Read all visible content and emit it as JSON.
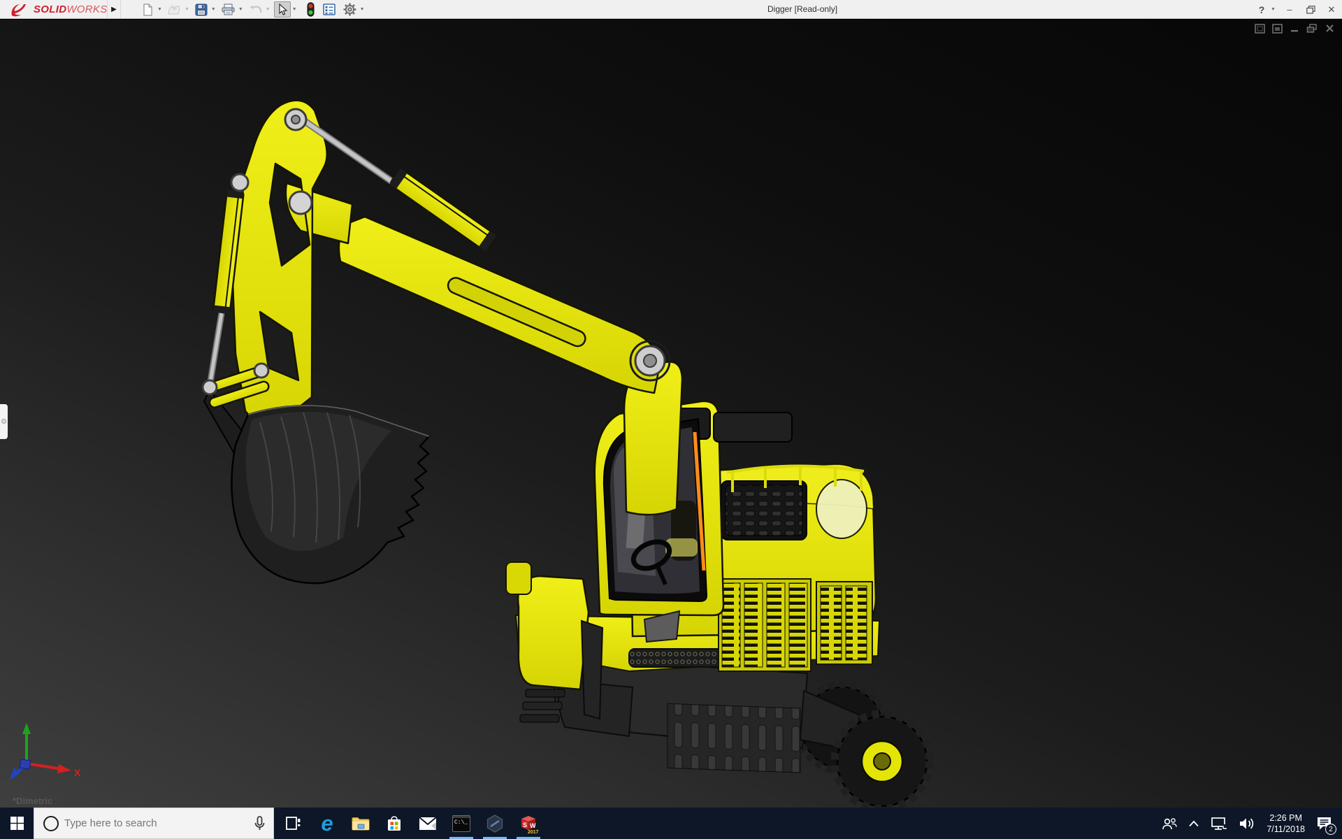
{
  "window": {
    "brand": {
      "prefix": "SOLID",
      "suffix": "WORKS"
    },
    "menu_expand_glyph": "▶",
    "title": "Digger [Read-only]",
    "help_label": "?",
    "controls": {
      "minimize": "–",
      "close": "✕"
    }
  },
  "toolbar": {
    "icons": [
      "new-document",
      "open",
      "save",
      "print",
      "undo",
      "select-tool",
      "performance-status",
      "evaluate-list",
      "options-gear"
    ]
  },
  "viewport": {
    "view_label": "*Dimetric",
    "triad": {
      "x_label": "X"
    },
    "doc_controls": [
      "new-window",
      "show-window",
      "minimize-document",
      "restore-document",
      "close-document"
    ]
  },
  "model": {
    "name": "Digger",
    "body_color": "#e4e407",
    "bucket_color": "#1f1f1f"
  },
  "taskbar": {
    "search": {
      "placeholder": "Type here to search"
    },
    "edge_letter": "e",
    "cmd_label": "C:\\_",
    "sw_cube": {
      "letters_s": "S",
      "letters_w": "W",
      "year": "2017"
    },
    "apps": [
      {
        "name": "task-view",
        "running": false
      },
      {
        "name": "edge",
        "running": false
      },
      {
        "name": "file-explorer",
        "running": false
      },
      {
        "name": "store",
        "running": false
      },
      {
        "name": "mail",
        "running": false
      },
      {
        "name": "command-prompt",
        "running": true
      },
      {
        "name": "hexagon-app",
        "running": true
      },
      {
        "name": "solidworks-2017",
        "running": true
      }
    ]
  },
  "tray": {
    "time": "2:26 PM",
    "date": "7/11/2018",
    "notification_count": "2"
  },
  "colors": {
    "taskbar": "#0d1728",
    "running_indicator": "#76b9ed",
    "brand_red": "#cf2030",
    "orange_strip": "#ff8c1a",
    "viewport_top": "#070707",
    "viewport_bottom": "#3f3f3f"
  }
}
